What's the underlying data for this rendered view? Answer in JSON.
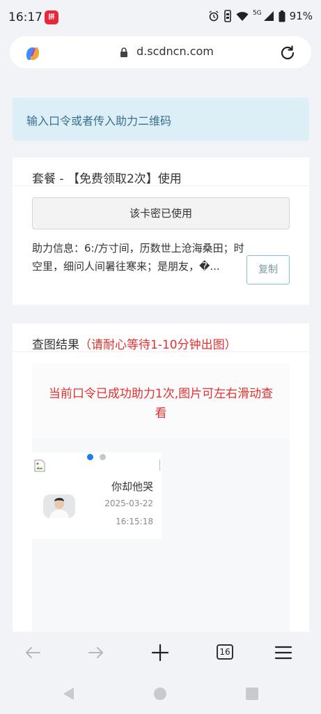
{
  "status_bar": {
    "time": "16:17",
    "app_icon_text": "拼多多",
    "network": "5G",
    "battery": "91%"
  },
  "browser": {
    "url": "d.scdncn.com"
  },
  "alert": {
    "text": "输入口令或者传入助力二维码"
  },
  "plan_card": {
    "title": "套餐 - 【免费领取2次】使用",
    "used_button": "该卡密已使用",
    "assist_info": "助力信息：6:/方寸间，历数世上沧海桑田；时空里，细问人间暑往寒来；是朋友，�...",
    "copy_button": "复制"
  },
  "result_card": {
    "title": "查图结果",
    "title_note": "（请耐心等待1-10分钟出图）",
    "success_message": "当前口令已成功助力1次,图片可左右滑动查看",
    "slide": {
      "nickname": "你却他哭",
      "date": "2025-03-22",
      "time": "16:15:18"
    }
  },
  "toolbar": {
    "tab_count": "16"
  },
  "colors": {
    "accent_red": "#e3302e",
    "alert_bg": "#dceef6",
    "alert_text": "#3a6f8e",
    "active_dot": "#1e7bf0",
    "copy_border": "#7fc4cf"
  },
  "icons": {
    "copilot": "copilot-icon",
    "lock": "lock-icon",
    "reload": "reload-icon",
    "back": "back-arrow-icon",
    "forward": "forward-arrow-icon",
    "new_tab": "plus-icon",
    "menu": "hamburger-menu-icon"
  }
}
